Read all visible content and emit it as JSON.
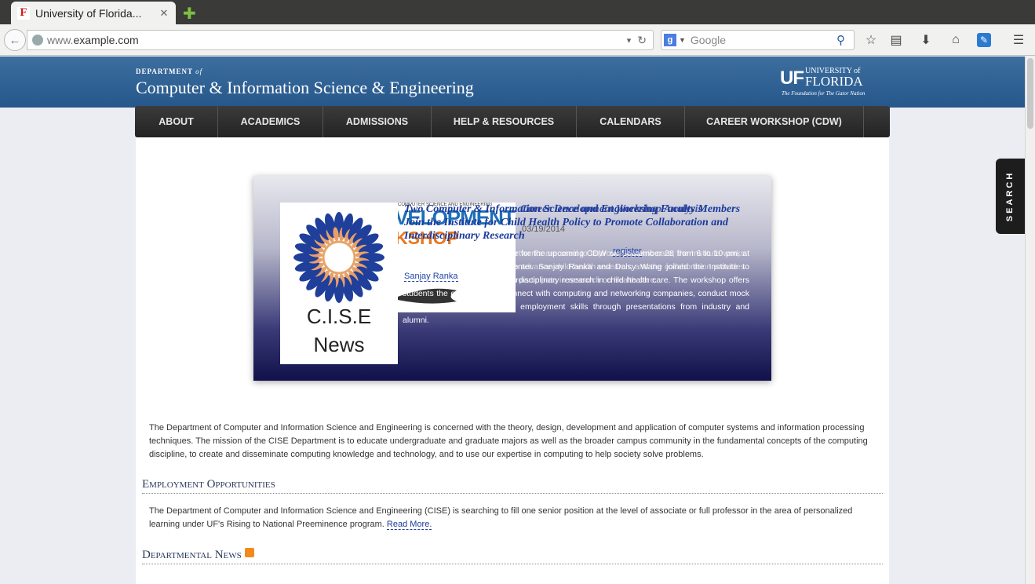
{
  "browser": {
    "tab_title": "University of Florida...",
    "tab_close": "✕",
    "favicon": "F",
    "new_tab": "✚",
    "url_prefix": "www.",
    "url_domain": "example.com",
    "url_dropdown": "▾",
    "reload": "↻",
    "search_engine": "g",
    "search_placeholder": "Google",
    "icons": [
      "back-icon",
      "globe-icon",
      "search-icon",
      "bookmark-star-icon",
      "reading-list-icon",
      "download-icon",
      "home-icon",
      "sync-icon",
      "menu-icon"
    ]
  },
  "site": {
    "dept_small": "DEPARTMENT",
    "dept_of": "of",
    "dept_name": "Computer & Information Science & Engineering",
    "logo_uf": "UF",
    "logo_university": "UNIVERSITY of",
    "logo_florida": "FLORIDA",
    "logo_tagline": "The Foundation for The Gator Nation"
  },
  "menu": [
    "ABOUT",
    "ACADEMICS",
    "ADMISSIONS",
    "HELP & RESOURCES",
    "CALENDARS",
    "CAREER WORKSHOP (CDW)"
  ],
  "slider": {
    "image_label_1": "C.I.S.E",
    "image_label_2": "News",
    "cdw_small": "COMPUTER SCIENCE AND ENGINEERING",
    "cdw_dev": "VELOPMENT",
    "cdw_shop": "KSHOP",
    "title": "Two Computer & Information Science and Engineering Faculty Members Join the Institute for Child Health Policy to Promote Collaboration and Interdisciplinary Research",
    "ghost_title": "Career Development Workshop Analysis",
    "date": "03/19/2014",
    "author": "Sanjay Ranka",
    "link": "register",
    "body": "Students, remember to register for the upcoming CDW on September 28 from 6 to 10 pm, at the UF Hilton Conference Center. Sanjay Ranka and Daisy Wang joined the Institute to promote collaboration and interdisciplinary research in child health care. The workshop offers students the opportunity to connect with computing and networking companies, conduct mock interviews, and improve their employment skills through presentations from industry and alumni.",
    "ghost_body": "Mobile computing and sensor networks are used to improve pediatric care; the Institute works with faculty across the College to advance child health research, and the collaboration provides new opportunities for students to participate in research on health care."
  },
  "intro": "The Department of Computer and Information Science and Engineering is concerned with the theory, design, development and application of computer systems and information processing techniques. The mission of the CISE Department is to educate undergraduate and graduate majors as well as the broader campus community in the fundamental concepts of the computing discipline, to create and disseminate computing knowledge and technology, and to use our expertise in computing to help society solve problems.",
  "employment": {
    "heading": "Employment Opportunities",
    "text": "The Department of Computer and Information Science and Engineering (CISE) is searching to fill one senior position at the level of associate or full professor in the area of personalized learning under UF's Rising to National Preeminence program.",
    "read_more": "Read More."
  },
  "news": {
    "heading": "Departmental News"
  },
  "search_tab": "SEARCH",
  "colors": {
    "banner": "#2f6496",
    "menu": "#2b2b2b",
    "link": "#1a3a9a",
    "slider_bottom": "#10104a"
  }
}
